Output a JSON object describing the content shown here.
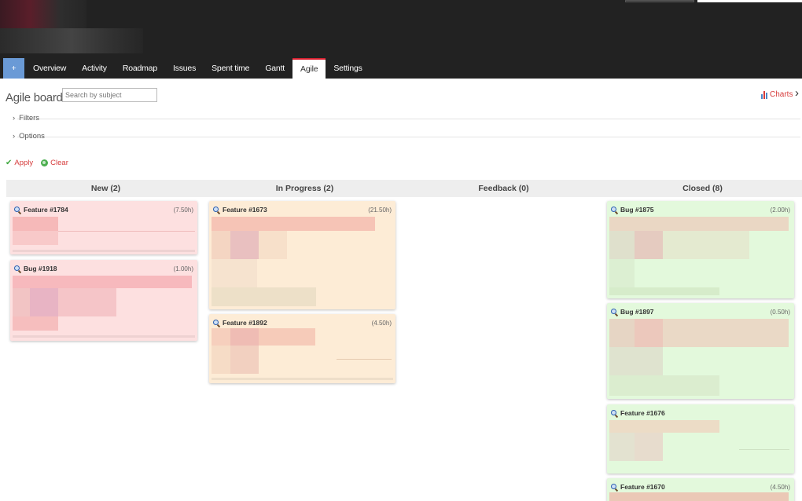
{
  "tabs": [
    {
      "label": "+"
    },
    {
      "label": "Overview"
    },
    {
      "label": "Activity"
    },
    {
      "label": "Roadmap"
    },
    {
      "label": "Issues"
    },
    {
      "label": "Spent time"
    },
    {
      "label": "Gantt"
    },
    {
      "label": "Agile"
    },
    {
      "label": "Settings"
    }
  ],
  "active_tab": "Agile",
  "page": {
    "title": "Agile board",
    "search_placeholder": "Search by subject",
    "charts_label": "Charts"
  },
  "filters_label": "Filters",
  "options_label": "Options",
  "apply_label": "Apply",
  "clear_label": "Clear",
  "columns": [
    {
      "label": "New (2)"
    },
    {
      "label": "In Progress (2)"
    },
    {
      "label": "Feedback (0)"
    },
    {
      "label": "Closed (8)"
    }
  ],
  "cards": {
    "new": [
      {
        "title": "Feature #1784",
        "hours": "(7.50h)"
      },
      {
        "title": "Bug #1918",
        "hours": "(1.00h)"
      }
    ],
    "in_progress": [
      {
        "title": "Feature #1673",
        "hours": "(21.50h)"
      },
      {
        "title": "Feature #1892",
        "hours": "(4.50h)"
      }
    ],
    "closed": [
      {
        "title": "Bug #1875",
        "hours": "(2.00h)"
      },
      {
        "title": "Bug #1897",
        "hours": "(0.50h)"
      },
      {
        "title": "Feature #1676",
        "hours": ""
      },
      {
        "title": "Feature #1670",
        "hours": "(4.50h)"
      }
    ]
  },
  "colors": {
    "header_bg": "#222222",
    "accent": "#d7202f",
    "new_card": "#fde0e0",
    "progress_card": "#fdecd6",
    "closed_card": "#e3f9dc",
    "link": "#d63b3b"
  }
}
